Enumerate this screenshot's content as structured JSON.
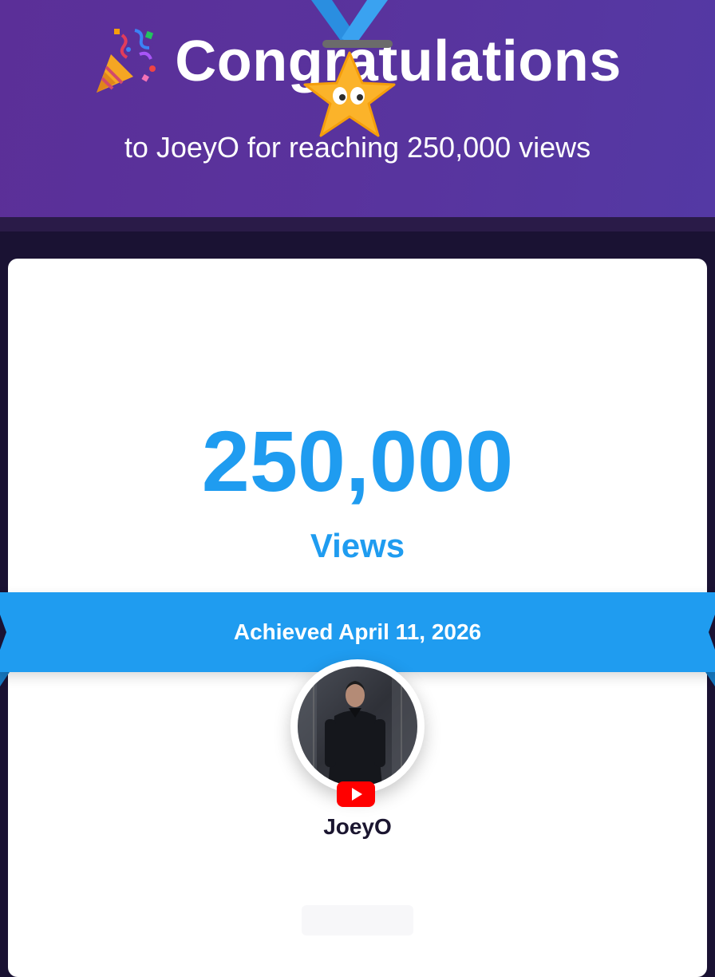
{
  "header": {
    "title": "Congratulations",
    "subtitle": "to JoeyO for reaching 250,000 views",
    "icon": "party-popper-icon"
  },
  "milestone": {
    "value": "250,000",
    "unit": "Views",
    "achieved": "Achieved April 11, 2026",
    "medal_icon": "star-medal-icon"
  },
  "channel": {
    "name": "JoeyO",
    "platform_icon": "youtube-icon"
  },
  "colors": {
    "header": "#5a339c",
    "accent_blue": "#1f9cf0",
    "background": "#1a1233",
    "card": "#ffffff",
    "star": "#fbb32a",
    "youtube_red": "#ff0000"
  }
}
